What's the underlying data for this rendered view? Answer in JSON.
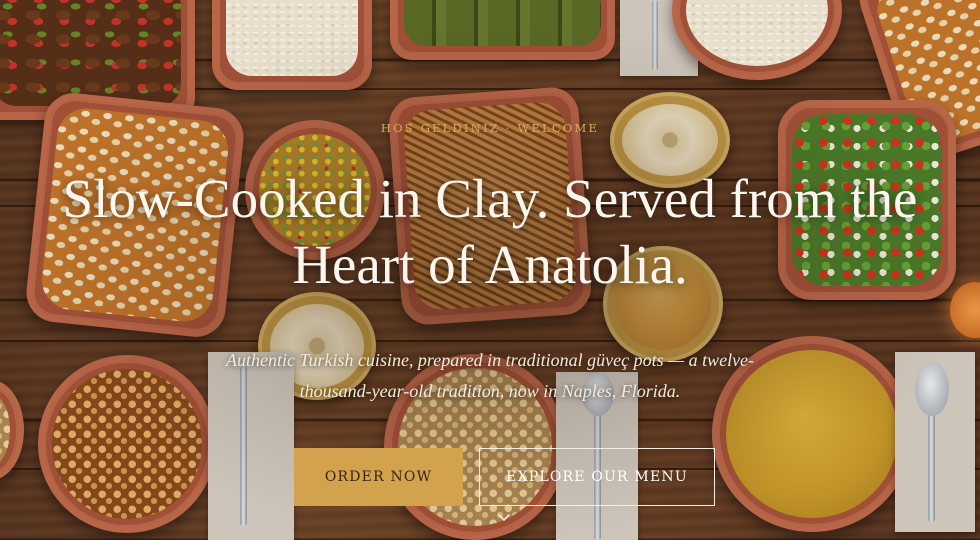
{
  "hero": {
    "eyebrow": "HOS GELDINIZ · WELCOME",
    "headline": "Slow-Cooked in Clay. Served from the Heart of Anatolia.",
    "subtext": "Authentic Turkish cuisine, prepared in traditional güveç pots — a twelve-thousand-year-old tradition, now in Naples, Florida.",
    "background_image": "overhead view of Turkish dishes in clay pots on a wooden table",
    "colors": {
      "accent_gold": "#d3a24c",
      "headline": "#fbf6ee",
      "eyebrow": "#d8ad5c"
    }
  },
  "buttons": {
    "order_label": "ORDER NOW",
    "menu_label": "EXPLORE OUR MENU"
  },
  "scroll_cue": {
    "icon": "chevron-down-icon"
  }
}
